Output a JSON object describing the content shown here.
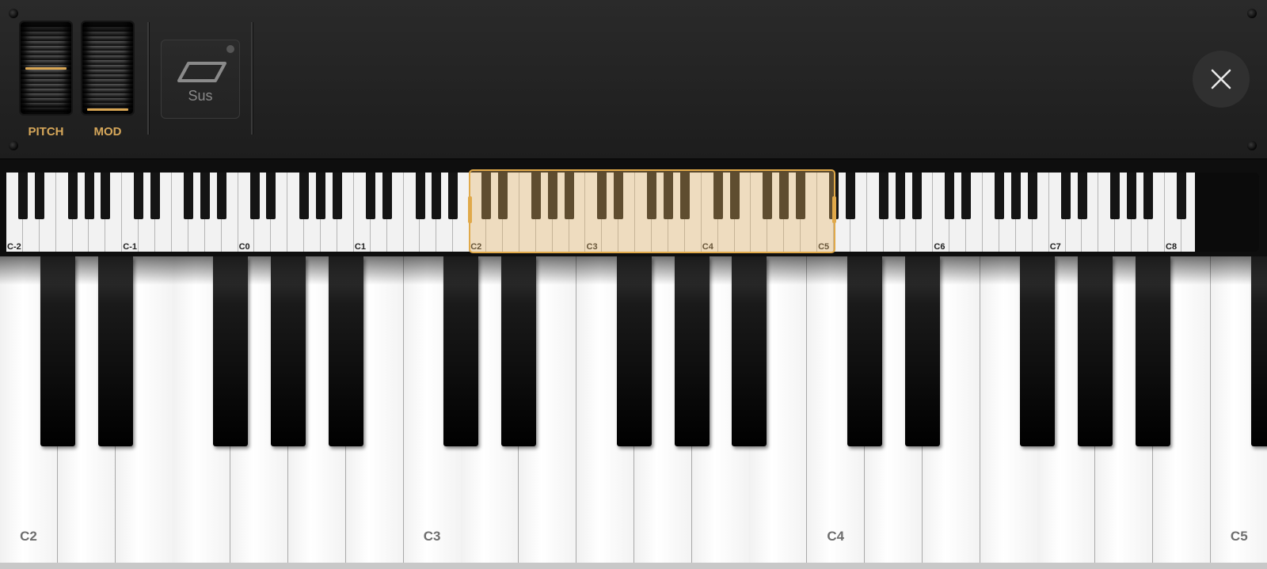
{
  "controls": {
    "pitch_label": "PITCH",
    "mod_label": "MOD",
    "sus_label": "Sus",
    "pitch_value": 0.5,
    "mod_value": 0.0,
    "accent_color": "#d6a75a",
    "close_icon": "close-icon",
    "sustain_icon": "sustain-pedal-icon"
  },
  "mini_keyboard": {
    "octave_labels": [
      "C-2",
      "C-1",
      "C0",
      "C1",
      "C2",
      "C3",
      "C4",
      "C5",
      "C6",
      "C7",
      "C8"
    ],
    "selected_range": {
      "start": "C2",
      "end": "C5"
    },
    "highlight_color": "#e0a94a"
  },
  "main_keyboard": {
    "octave_labels": [
      "C2",
      "C3",
      "C4",
      "C5"
    ]
  }
}
